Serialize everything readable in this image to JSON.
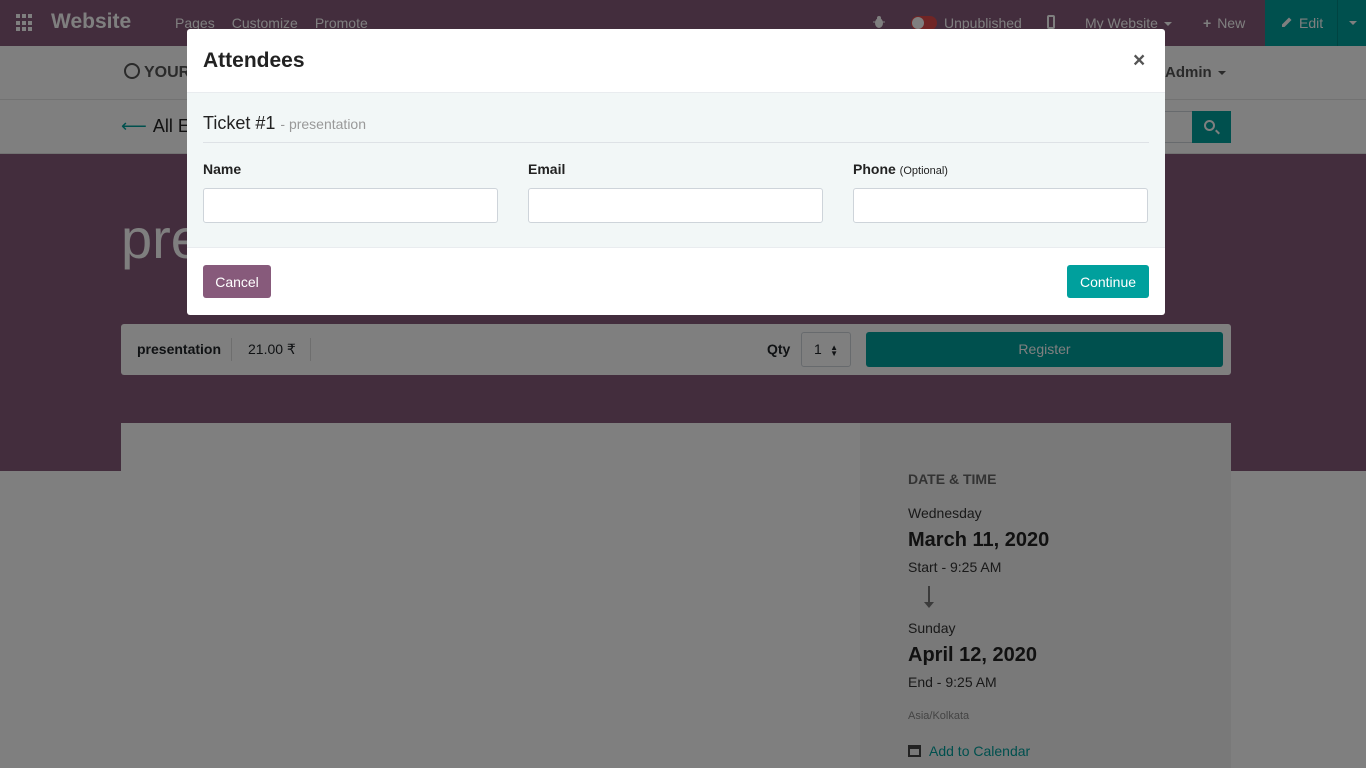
{
  "topbar": {
    "brand": "Website",
    "menu": [
      "Pages",
      "Customize",
      "Promote"
    ],
    "publish_status": "Unpublished",
    "website_selector": "My Website",
    "new_label": "New",
    "edit_label": "Edit"
  },
  "site_header": {
    "logo_text": "YOUR",
    "user_label": "Admin"
  },
  "subnav": {
    "back_label": "All Ev"
  },
  "event": {
    "title_fragment": "pre",
    "ticket_name": "presentation",
    "ticket_price": "21.00 ₹",
    "qty_label": "Qty",
    "qty_value": "1",
    "register_label": "Register"
  },
  "sidebar": {
    "heading": "DATE & TIME",
    "start_day": "Wednesday",
    "start_date": "March 11, 2020",
    "start_time": "Start - 9:25 AM",
    "end_day": "Sunday",
    "end_date": "April 12, 2020",
    "end_time": "End - 9:25 AM",
    "timezone": "Asia/Kolkata",
    "calendar_link": "Add to Calendar"
  },
  "modal": {
    "title": "Attendees",
    "close_glyph": "×",
    "ticket_heading": "Ticket #1",
    "ticket_sub": "- presentation",
    "fields": {
      "name_label": "Name",
      "name_value": "",
      "email_label": "Email",
      "email_value": "",
      "phone_label": "Phone",
      "phone_optional": "(Optional)",
      "phone_value": ""
    },
    "cancel_label": "Cancel",
    "continue_label": "Continue"
  },
  "colors": {
    "brand_purple": "#875a7b",
    "accent_teal": "#00a09d",
    "toggle_red": "#e04b4b"
  }
}
